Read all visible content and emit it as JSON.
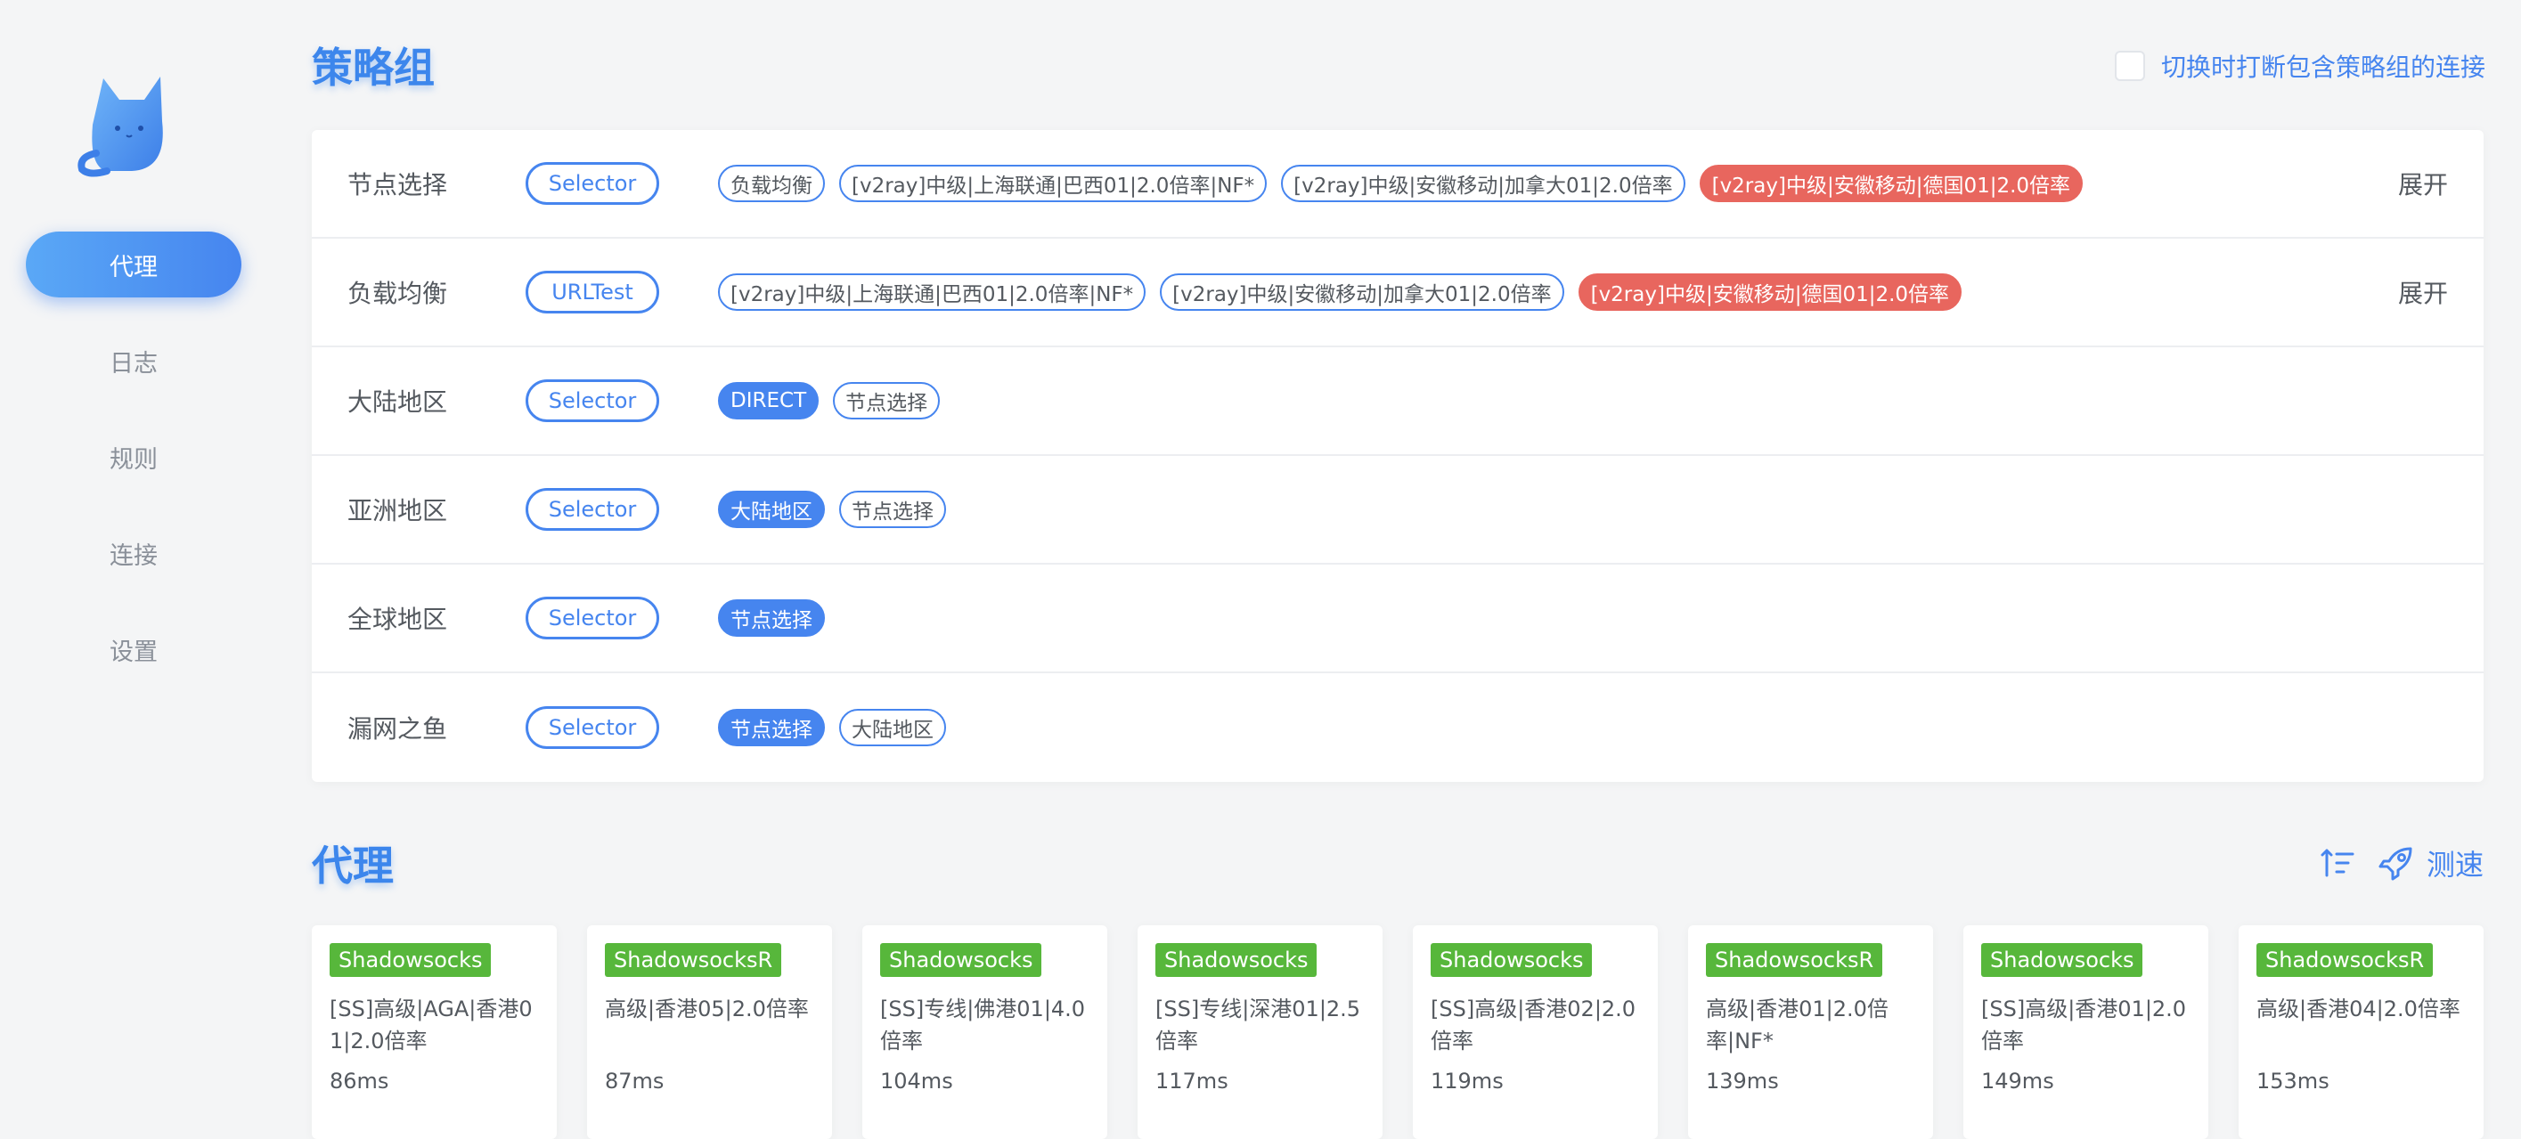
{
  "sidebar": {
    "items": [
      {
        "label": "代理",
        "active": true
      },
      {
        "label": "日志"
      },
      {
        "label": "规则"
      },
      {
        "label": "连接"
      },
      {
        "label": "设置"
      }
    ]
  },
  "groups_section": {
    "title": "策略组",
    "interrupt_label": "切换时打断包含策略组的连接",
    "expand_label": "展开",
    "groups": [
      {
        "name": "节点选择",
        "type": "Selector",
        "expandable": true,
        "proxies": [
          {
            "label": "负载均衡",
            "state": "normal"
          },
          {
            "label": "[v2ray]中级|上海联通|巴西01|2.0倍率|NF*",
            "state": "normal"
          },
          {
            "label": "[v2ray]中级|安徽移动|加拿大01|2.0倍率",
            "state": "normal"
          },
          {
            "label": "[v2ray]中级|安徽移动|德国01|2.0倍率",
            "state": "failed"
          }
        ]
      },
      {
        "name": "负载均衡",
        "type": "URLTest",
        "expandable": true,
        "proxies": [
          {
            "label": "[v2ray]中级|上海联通|巴西01|2.0倍率|NF*",
            "state": "normal"
          },
          {
            "label": "[v2ray]中级|安徽移动|加拿大01|2.0倍率",
            "state": "normal"
          },
          {
            "label": "[v2ray]中级|安徽移动|德国01|2.0倍率",
            "state": "failed"
          }
        ]
      },
      {
        "name": "大陆地区",
        "type": "Selector",
        "expandable": false,
        "proxies": [
          {
            "label": "DIRECT",
            "state": "selected"
          },
          {
            "label": "节点选择",
            "state": "normal"
          }
        ]
      },
      {
        "name": "亚洲地区",
        "type": "Selector",
        "expandable": false,
        "proxies": [
          {
            "label": "大陆地区",
            "state": "selected"
          },
          {
            "label": "节点选择",
            "state": "normal"
          }
        ]
      },
      {
        "name": "全球地区",
        "type": "Selector",
        "expandable": false,
        "proxies": [
          {
            "label": "节点选择",
            "state": "selected"
          }
        ]
      },
      {
        "name": "漏网之鱼",
        "type": "Selector",
        "expandable": false,
        "proxies": [
          {
            "label": "节点选择",
            "state": "selected"
          },
          {
            "label": "大陆地区",
            "state": "normal"
          }
        ]
      }
    ]
  },
  "proxies_section": {
    "title": "代理",
    "speedtest_label": "测速",
    "icons": {
      "sort": "sort-icon",
      "speedtest": "rocket-icon"
    },
    "cards": [
      {
        "type": "Shadowsocks",
        "name": "[SS]高级|AGA|香港01|2.0倍率",
        "delay": "86ms"
      },
      {
        "type": "ShadowsocksR",
        "name": "高级|香港05|2.0倍率",
        "delay": "87ms"
      },
      {
        "type": "Shadowsocks",
        "name": "[SS]专线|佛港01|4.0倍率",
        "delay": "104ms"
      },
      {
        "type": "Shadowsocks",
        "name": "[SS]专线|深港01|2.5倍率",
        "delay": "117ms"
      },
      {
        "type": "Shadowsocks",
        "name": "[SS]高级|香港02|2.0倍率",
        "delay": "119ms"
      },
      {
        "type": "ShadowsocksR",
        "name": "高级|香港01|2.0倍率|NF*",
        "delay": "139ms"
      },
      {
        "type": "Shadowsocks",
        "name": "[SS]高级|香港01|2.0倍率",
        "delay": "149ms"
      },
      {
        "type": "ShadowsocksR",
        "name": "高级|香港04|2.0倍率",
        "delay": "153ms"
      }
    ]
  },
  "colors": {
    "accent": "#4685ef",
    "failed": "#e8665e",
    "proxy_type_badge": "#57b73b"
  }
}
